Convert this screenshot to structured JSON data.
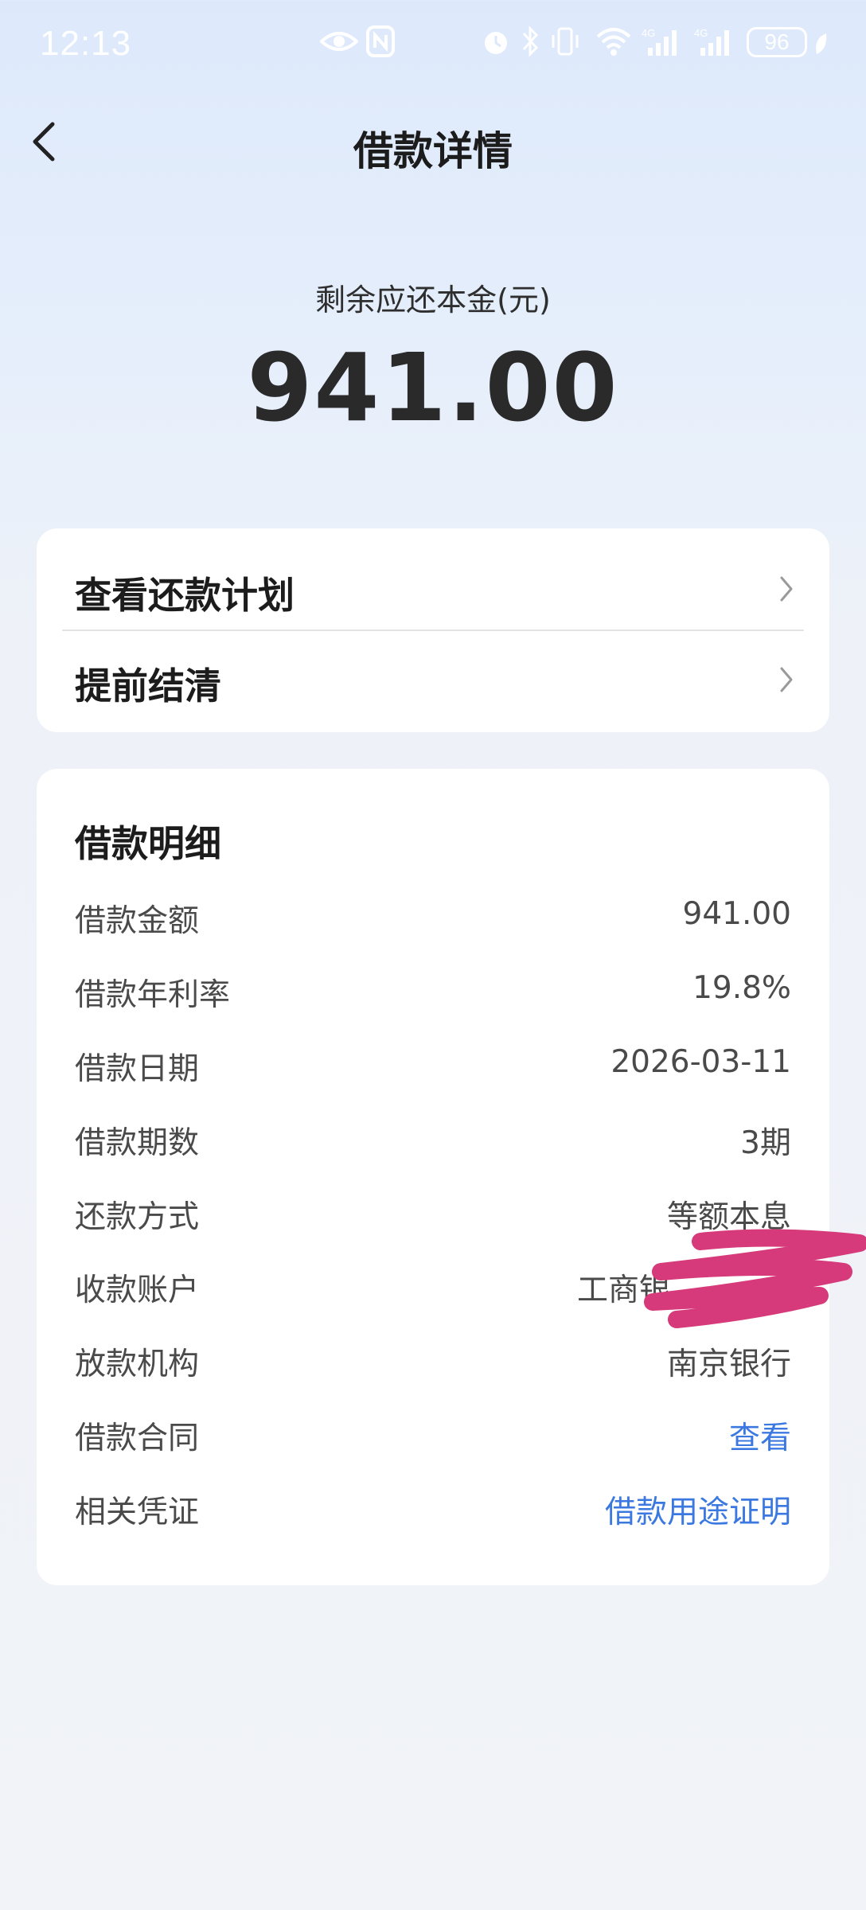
{
  "status_bar": {
    "time": "12:13",
    "battery": "96",
    "icons": [
      "eye-icon",
      "nfc-icon",
      "alarm-icon",
      "bluetooth-icon",
      "vibrate-icon",
      "wifi-icon",
      "signal-4g-icon",
      "signal-4g-icon",
      "leaf-icon"
    ]
  },
  "header": {
    "title": "借款详情",
    "back_icon": "chevron-left-icon"
  },
  "summary": {
    "label": "剩余应还本金(元)",
    "amount": "941.00"
  },
  "actions": [
    {
      "label": "查看还款计划",
      "icon": "chevron-right-icon"
    },
    {
      "label": "提前结清",
      "icon": "chevron-right-icon"
    }
  ],
  "details": {
    "title": "借款明细",
    "rows": [
      {
        "key": "借款金额",
        "value": "941.00"
      },
      {
        "key": "借款年利率",
        "value": "19.8%"
      },
      {
        "key": "借款日期",
        "value": "2026-03-11"
      },
      {
        "key": "借款期数",
        "value": "3期"
      },
      {
        "key": "还款方式",
        "value": "等额本息"
      },
      {
        "key": "收款账户",
        "value": "工商银"
      },
      {
        "key": "放款机构",
        "value": "南京银行"
      },
      {
        "key": "借款合同",
        "value": "查看",
        "link": true
      },
      {
        "key": "相关凭证",
        "value": "借款用途证明",
        "link": true
      }
    ]
  },
  "colors": {
    "link": "#3b78e0",
    "redaction": "#d63a7a",
    "card": "#ffffff"
  }
}
